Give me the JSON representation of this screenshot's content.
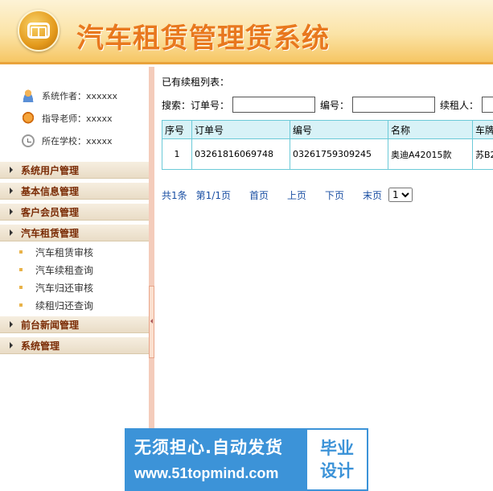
{
  "header": {
    "title": "汽车租赁管理赁系统"
  },
  "sidebar": {
    "info": [
      {
        "icon": "user-icon",
        "text": "系统作者：xxxxxx"
      },
      {
        "icon": "teacher-icon",
        "text": "指导老师：xxxxx"
      },
      {
        "icon": "school-icon",
        "text": "所在学校：xxxxx"
      }
    ],
    "menu": [
      {
        "label": "系统用户管理"
      },
      {
        "label": "基本信息管理"
      },
      {
        "label": "客户会员管理"
      },
      {
        "label": "汽车租赁管理",
        "items": [
          "汽车租赁审核",
          "汽车续租查询",
          "汽车归还审核",
          "续租归还查询"
        ]
      },
      {
        "label": "前台新闻管理"
      },
      {
        "label": "系统管理"
      }
    ]
  },
  "main": {
    "list_title": "已有续租列表：",
    "search": {
      "label": "搜索：",
      "order_label": "订单号：",
      "code_label": "编号：",
      "renter_label": "续租人：",
      "order_value": "",
      "code_value": "",
      "renter_value": ""
    },
    "table": {
      "headers": [
        "序号",
        "订单号",
        "编号",
        "名称",
        "车牌"
      ],
      "rows": [
        [
          "1",
          "03261816069748",
          "03261759309245",
          "奥迪A42015款",
          "苏B2"
        ]
      ]
    },
    "pager": {
      "total": "共1条",
      "page": "第1/1页",
      "first": "首页",
      "prev": "上页",
      "next": "下页",
      "last": "末页",
      "selected": "1"
    }
  },
  "watermark": {
    "line1": "无须担心.自动发货",
    "line2": "www.51topmind.com",
    "badge1": "毕业",
    "badge2": "设计"
  }
}
